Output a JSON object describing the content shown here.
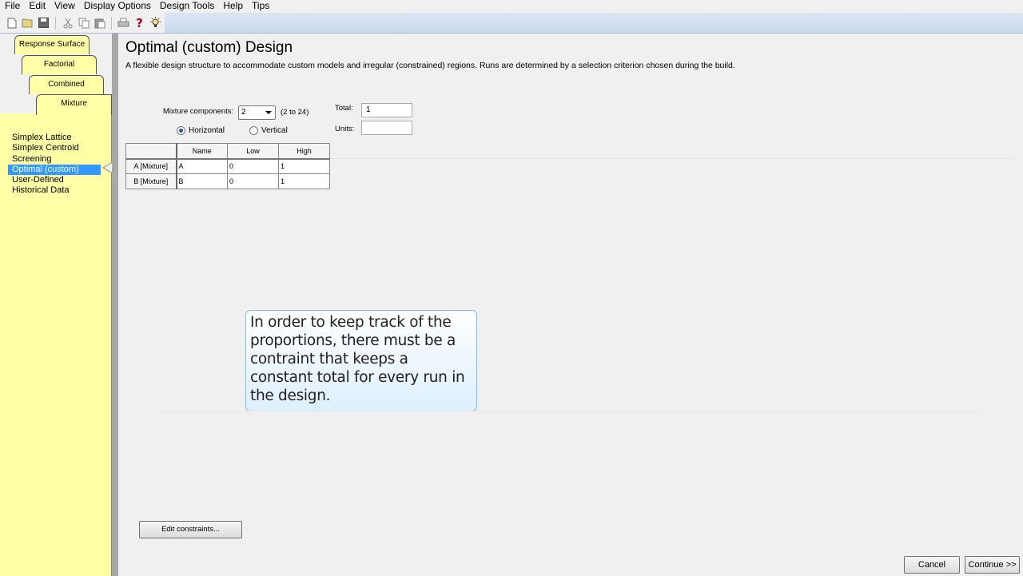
{
  "menu": [
    "File",
    "Edit",
    "View",
    "Display Options",
    "Design Tools",
    "Help",
    "Tips"
  ],
  "toolbar": {
    "icons": [
      "new-file-icon",
      "open-folder-icon",
      "save-icon",
      "cut-icon",
      "copy-icon",
      "paste-icon",
      "print-icon",
      "help-icon",
      "tip-lightbulb-icon"
    ],
    "help_glyph": "?"
  },
  "sidebar": {
    "tabs": [
      "Response Surface",
      "Factorial",
      "Combined",
      "Mixture"
    ],
    "items": [
      {
        "label": "Simplex Lattice",
        "selected": false
      },
      {
        "label": "Simplex Centroid",
        "selected": false
      },
      {
        "label": "Screening",
        "selected": false
      },
      {
        "label": "Optimal (custom)",
        "selected": true
      },
      {
        "label": "User-Defined",
        "selected": false
      },
      {
        "label": "Historical Data",
        "selected": false
      }
    ]
  },
  "main": {
    "title": "Optimal (custom) Design",
    "description": "A flexible design structure to accommodate custom models and irregular (constrained) regions.  Runs are determined by a selection criterion chosen during the build.",
    "mixture_components_label": "Mixture components:",
    "mixture_components_value": "2",
    "mixture_components_range": "(2 to 24)",
    "total_label": "Total:",
    "total_value": "1",
    "units_label": "Units:",
    "units_value": "",
    "orientation": {
      "horizontal": "Horizontal",
      "vertical": "Vertical",
      "selected": "Horizontal"
    },
    "table": {
      "columns": [
        "Name",
        "Low",
        "High"
      ],
      "rows": [
        {
          "header": "A [Mixture]",
          "name": "A",
          "low": "0",
          "high": "1"
        },
        {
          "header": "B [Mixture]",
          "name": "B",
          "low": "0",
          "high": "1"
        }
      ]
    },
    "callout": "In order to keep track of the proportions, there must be a contraint that keeps a constant total for every run in the design.",
    "edit_constraints_button": "Edit constraints...",
    "cancel_button": "Cancel",
    "continue_button": "Continue >>"
  }
}
